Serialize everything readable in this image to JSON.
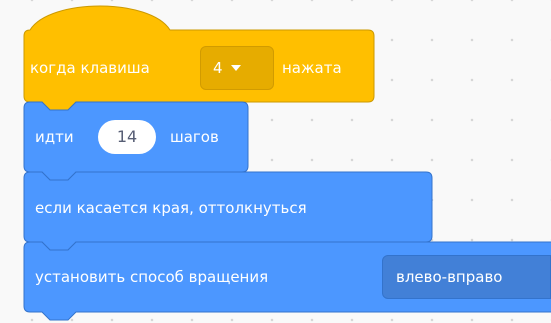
{
  "blocks": {
    "hat": {
      "label_before": "когда клавиша",
      "key_value": "4",
      "label_after": "нажата"
    },
    "move": {
      "label_before": "идти",
      "steps_value": "14",
      "label_after": "шагов"
    },
    "bounce": {
      "label": "если касается края, оттолкнуться"
    },
    "rotation": {
      "label": "установить способ вращения",
      "style_value": "влево-вправо"
    }
  },
  "colors": {
    "events": "#ffbf00",
    "events_border": "#cc9900",
    "motion": "#4c97ff",
    "motion_border": "#3373cc",
    "workspace": "#f9f9f9"
  }
}
